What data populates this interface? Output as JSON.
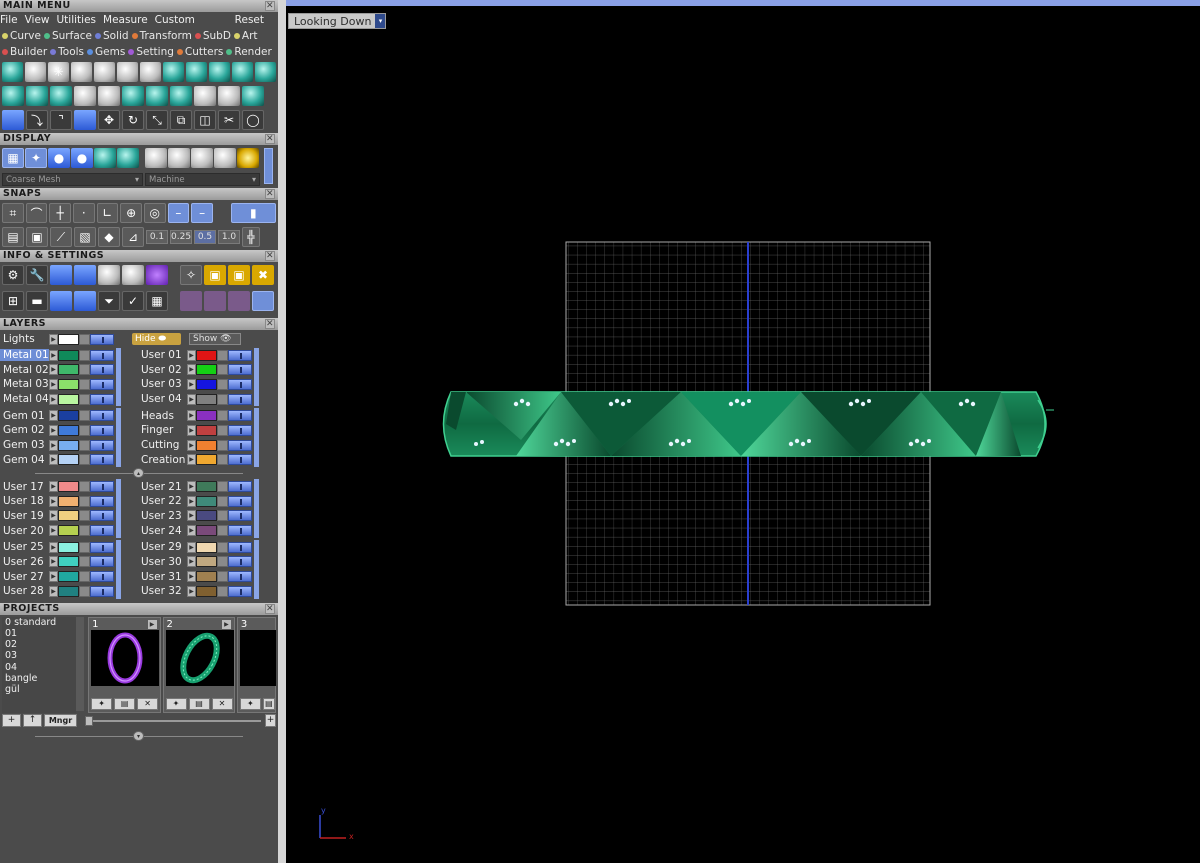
{
  "main_menu": {
    "title": "MAIN MENU",
    "menus": [
      "File",
      "View",
      "Utilities",
      "Measure",
      "Custom"
    ],
    "reset": "Reset",
    "categories_row1": [
      {
        "label": "Curve",
        "color": "#d9d36a"
      },
      {
        "label": "Surface",
        "color": "#4fbf8a"
      },
      {
        "label": "Solid",
        "color": "#6f7ed6"
      },
      {
        "label": "Transform",
        "color": "#e07a3a"
      },
      {
        "label": "SubD",
        "color": "#d95050"
      },
      {
        "label": "Art",
        "color": "#d9d36a"
      }
    ],
    "categories_row2": [
      {
        "label": "Builder",
        "color": "#d95050"
      },
      {
        "label": "Tools",
        "color": "#7a7ad6"
      },
      {
        "label": "Gems",
        "color": "#5a8ee0"
      },
      {
        "label": "Setting",
        "color": "#a05ad6"
      },
      {
        "label": "Cutters",
        "color": "#e07a3a"
      },
      {
        "label": "Render",
        "color": "#4fbf8a"
      }
    ]
  },
  "display": {
    "title": "DISPLAY",
    "mesh_mode": "Coarse Mesh",
    "material_mode": "Machine"
  },
  "snaps": {
    "title": "SNAPS",
    "values": [
      "0.1",
      "0.25",
      "0.5",
      "1.0"
    ],
    "selected_value": "0.5"
  },
  "info": {
    "title": "INFO & SETTINGS"
  },
  "layers": {
    "title": "LAYERS",
    "lights_label": "Lights",
    "hide_label": "Hide",
    "show_label": "Show",
    "groups": [
      {
        "left": [
          {
            "name": "Metal 01",
            "color": "#0f8a5a",
            "selected": true
          },
          {
            "name": "Metal 02",
            "color": "#3fb86a"
          },
          {
            "name": "Metal 03",
            "color": "#8be06a"
          },
          {
            "name": "Metal 04",
            "color": "#b8f5a0"
          }
        ],
        "right": [
          {
            "name": "User 01",
            "color": "#e01515"
          },
          {
            "name": "User 02",
            "color": "#15d015"
          },
          {
            "name": "User 03",
            "color": "#1515e0"
          },
          {
            "name": "User 04",
            "color": "#808080"
          }
        ]
      },
      {
        "left": [
          {
            "name": "Gem 01",
            "color": "#1a3fa0"
          },
          {
            "name": "Gem 02",
            "color": "#3f7ad9"
          },
          {
            "name": "Gem 03",
            "color": "#78aef0"
          },
          {
            "name": "Gem 04",
            "color": "#b5d2f5"
          }
        ],
        "right": [
          {
            "name": "Heads",
            "color": "#8a30c0"
          },
          {
            "name": "Finger",
            "color": "#c04040"
          },
          {
            "name": "Cutting",
            "color": "#f08030"
          },
          {
            "name": "Creation",
            "color": "#f0a830"
          }
        ]
      },
      {
        "left": [
          {
            "name": "User 17",
            "color": "#f08a8a"
          },
          {
            "name": "User 18",
            "color": "#f0b070"
          },
          {
            "name": "User 19",
            "color": "#f0d080"
          },
          {
            "name": "User 20",
            "color": "#b5d050"
          }
        ],
        "right": [
          {
            "name": "User 21",
            "color": "#3f7a5a"
          },
          {
            "name": "User 22",
            "color": "#3f8a7a"
          },
          {
            "name": "User 23",
            "color": "#4a4a80"
          },
          {
            "name": "User 24",
            "color": "#7a4a7a"
          }
        ]
      },
      {
        "left": [
          {
            "name": "User 25",
            "color": "#8af0e0"
          },
          {
            "name": "User 26",
            "color": "#40d0c0"
          },
          {
            "name": "User 27",
            "color": "#20a8a0"
          },
          {
            "name": "User 28",
            "color": "#208080"
          }
        ],
        "right": [
          {
            "name": "User 29",
            "color": "#f0d8b0"
          },
          {
            "name": "User 30",
            "color": "#c0a880"
          },
          {
            "name": "User 31",
            "color": "#a08050"
          },
          {
            "name": "User 32",
            "color": "#806030"
          }
        ]
      }
    ]
  },
  "projects": {
    "title": "PROJECTS",
    "list": [
      "0 standard",
      "01",
      "02",
      "03",
      "04",
      "bangle",
      "gül"
    ],
    "thumbs": [
      {
        "num": "1"
      },
      {
        "num": "2"
      },
      {
        "num": "3"
      }
    ],
    "mngr_label": "Mngr"
  },
  "viewport": {
    "view_label": "Looking Down",
    "axis_x": "x",
    "axis_y": "y"
  }
}
